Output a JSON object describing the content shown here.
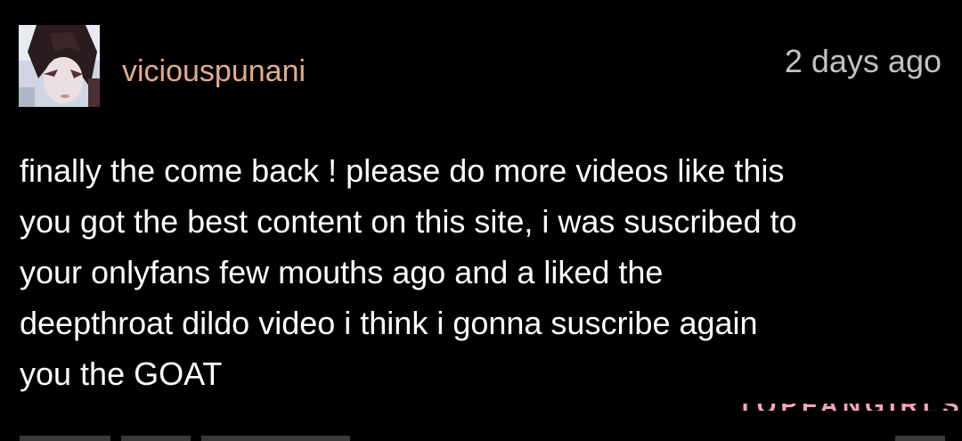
{
  "comment": {
    "username": "viciouspunani",
    "timestamp": "2 days ago",
    "body_lines": [
      "finally the come back ! please do more videos like this",
      "you got the best content on this site, i was suscribed to",
      "your onlyfans few mouths ago and a liked the",
      "deepthroat dildo video i think i gonna suscribe again",
      "you the GOAT"
    ]
  },
  "watermark": {
    "text": "TOPFANGIRLS",
    "color": "#f4a3bf"
  },
  "colors": {
    "background": "#000000",
    "username": "#e0ac8d",
    "timestamp": "#c2c2c2",
    "body_text": "#ffffff"
  }
}
